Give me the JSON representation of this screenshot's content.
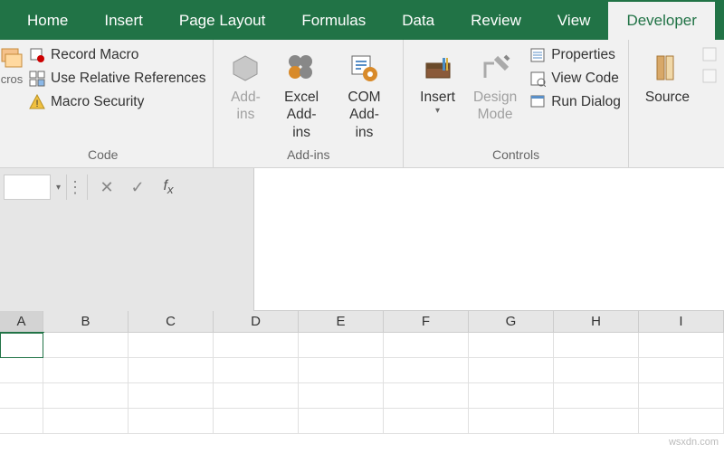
{
  "tabs": [
    "Home",
    "Insert",
    "Page Layout",
    "Formulas",
    "Data",
    "Review",
    "View",
    "Developer"
  ],
  "active_tab": "Developer",
  "ribbon": {
    "code": {
      "label": "Code",
      "record_macro": "Record Macro",
      "use_relative": "Use Relative References",
      "macro_security": "Macro Security"
    },
    "addins": {
      "label": "Add-ins",
      "addins_btn": "Add-\nins",
      "excel_addins": "Excel\nAdd-ins",
      "com_addins": "COM\nAdd-ins"
    },
    "controls": {
      "label": "Controls",
      "insert": "Insert",
      "design_mode": "Design\nMode",
      "properties": "Properties",
      "view_code": "View Code",
      "run_dialog": "Run Dialog"
    },
    "source": "Source"
  },
  "columns": [
    "A",
    "B",
    "C",
    "D",
    "E",
    "F",
    "G",
    "H",
    "I"
  ],
  "selected_cell": "A1",
  "watermark": "wsxdn.com"
}
